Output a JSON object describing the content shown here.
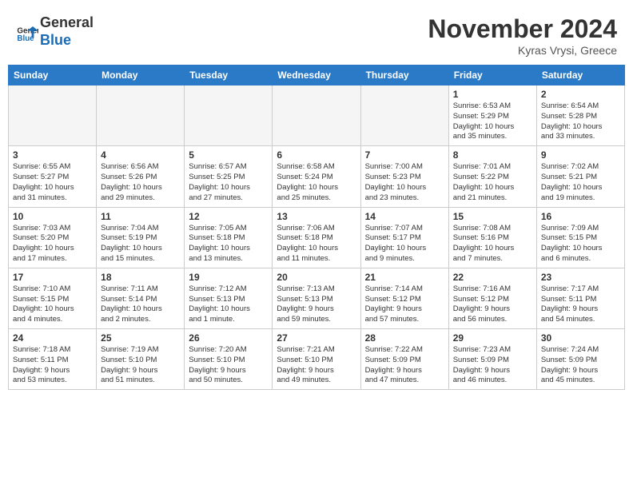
{
  "header": {
    "logo_line1": "General",
    "logo_line2": "Blue",
    "month_year": "November 2024",
    "location": "Kyras Vrysi, Greece"
  },
  "weekdays": [
    "Sunday",
    "Monday",
    "Tuesday",
    "Wednesday",
    "Thursday",
    "Friday",
    "Saturday"
  ],
  "weeks": [
    [
      {
        "day": "",
        "info": ""
      },
      {
        "day": "",
        "info": ""
      },
      {
        "day": "",
        "info": ""
      },
      {
        "day": "",
        "info": ""
      },
      {
        "day": "",
        "info": ""
      },
      {
        "day": "1",
        "info": "Sunrise: 6:53 AM\nSunset: 5:29 PM\nDaylight: 10 hours\nand 35 minutes."
      },
      {
        "day": "2",
        "info": "Sunrise: 6:54 AM\nSunset: 5:28 PM\nDaylight: 10 hours\nand 33 minutes."
      }
    ],
    [
      {
        "day": "3",
        "info": "Sunrise: 6:55 AM\nSunset: 5:27 PM\nDaylight: 10 hours\nand 31 minutes."
      },
      {
        "day": "4",
        "info": "Sunrise: 6:56 AM\nSunset: 5:26 PM\nDaylight: 10 hours\nand 29 minutes."
      },
      {
        "day": "5",
        "info": "Sunrise: 6:57 AM\nSunset: 5:25 PM\nDaylight: 10 hours\nand 27 minutes."
      },
      {
        "day": "6",
        "info": "Sunrise: 6:58 AM\nSunset: 5:24 PM\nDaylight: 10 hours\nand 25 minutes."
      },
      {
        "day": "7",
        "info": "Sunrise: 7:00 AM\nSunset: 5:23 PM\nDaylight: 10 hours\nand 23 minutes."
      },
      {
        "day": "8",
        "info": "Sunrise: 7:01 AM\nSunset: 5:22 PM\nDaylight: 10 hours\nand 21 minutes."
      },
      {
        "day": "9",
        "info": "Sunrise: 7:02 AM\nSunset: 5:21 PM\nDaylight: 10 hours\nand 19 minutes."
      }
    ],
    [
      {
        "day": "10",
        "info": "Sunrise: 7:03 AM\nSunset: 5:20 PM\nDaylight: 10 hours\nand 17 minutes."
      },
      {
        "day": "11",
        "info": "Sunrise: 7:04 AM\nSunset: 5:19 PM\nDaylight: 10 hours\nand 15 minutes."
      },
      {
        "day": "12",
        "info": "Sunrise: 7:05 AM\nSunset: 5:18 PM\nDaylight: 10 hours\nand 13 minutes."
      },
      {
        "day": "13",
        "info": "Sunrise: 7:06 AM\nSunset: 5:18 PM\nDaylight: 10 hours\nand 11 minutes."
      },
      {
        "day": "14",
        "info": "Sunrise: 7:07 AM\nSunset: 5:17 PM\nDaylight: 10 hours\nand 9 minutes."
      },
      {
        "day": "15",
        "info": "Sunrise: 7:08 AM\nSunset: 5:16 PM\nDaylight: 10 hours\nand 7 minutes."
      },
      {
        "day": "16",
        "info": "Sunrise: 7:09 AM\nSunset: 5:15 PM\nDaylight: 10 hours\nand 6 minutes."
      }
    ],
    [
      {
        "day": "17",
        "info": "Sunrise: 7:10 AM\nSunset: 5:15 PM\nDaylight: 10 hours\nand 4 minutes."
      },
      {
        "day": "18",
        "info": "Sunrise: 7:11 AM\nSunset: 5:14 PM\nDaylight: 10 hours\nand 2 minutes."
      },
      {
        "day": "19",
        "info": "Sunrise: 7:12 AM\nSunset: 5:13 PM\nDaylight: 10 hours\nand 1 minute."
      },
      {
        "day": "20",
        "info": "Sunrise: 7:13 AM\nSunset: 5:13 PM\nDaylight: 9 hours\nand 59 minutes."
      },
      {
        "day": "21",
        "info": "Sunrise: 7:14 AM\nSunset: 5:12 PM\nDaylight: 9 hours\nand 57 minutes."
      },
      {
        "day": "22",
        "info": "Sunrise: 7:16 AM\nSunset: 5:12 PM\nDaylight: 9 hours\nand 56 minutes."
      },
      {
        "day": "23",
        "info": "Sunrise: 7:17 AM\nSunset: 5:11 PM\nDaylight: 9 hours\nand 54 minutes."
      }
    ],
    [
      {
        "day": "24",
        "info": "Sunrise: 7:18 AM\nSunset: 5:11 PM\nDaylight: 9 hours\nand 53 minutes."
      },
      {
        "day": "25",
        "info": "Sunrise: 7:19 AM\nSunset: 5:10 PM\nDaylight: 9 hours\nand 51 minutes."
      },
      {
        "day": "26",
        "info": "Sunrise: 7:20 AM\nSunset: 5:10 PM\nDaylight: 9 hours\nand 50 minutes."
      },
      {
        "day": "27",
        "info": "Sunrise: 7:21 AM\nSunset: 5:10 PM\nDaylight: 9 hours\nand 49 minutes."
      },
      {
        "day": "28",
        "info": "Sunrise: 7:22 AM\nSunset: 5:09 PM\nDaylight: 9 hours\nand 47 minutes."
      },
      {
        "day": "29",
        "info": "Sunrise: 7:23 AM\nSunset: 5:09 PM\nDaylight: 9 hours\nand 46 minutes."
      },
      {
        "day": "30",
        "info": "Sunrise: 7:24 AM\nSunset: 5:09 PM\nDaylight: 9 hours\nand 45 minutes."
      }
    ]
  ]
}
